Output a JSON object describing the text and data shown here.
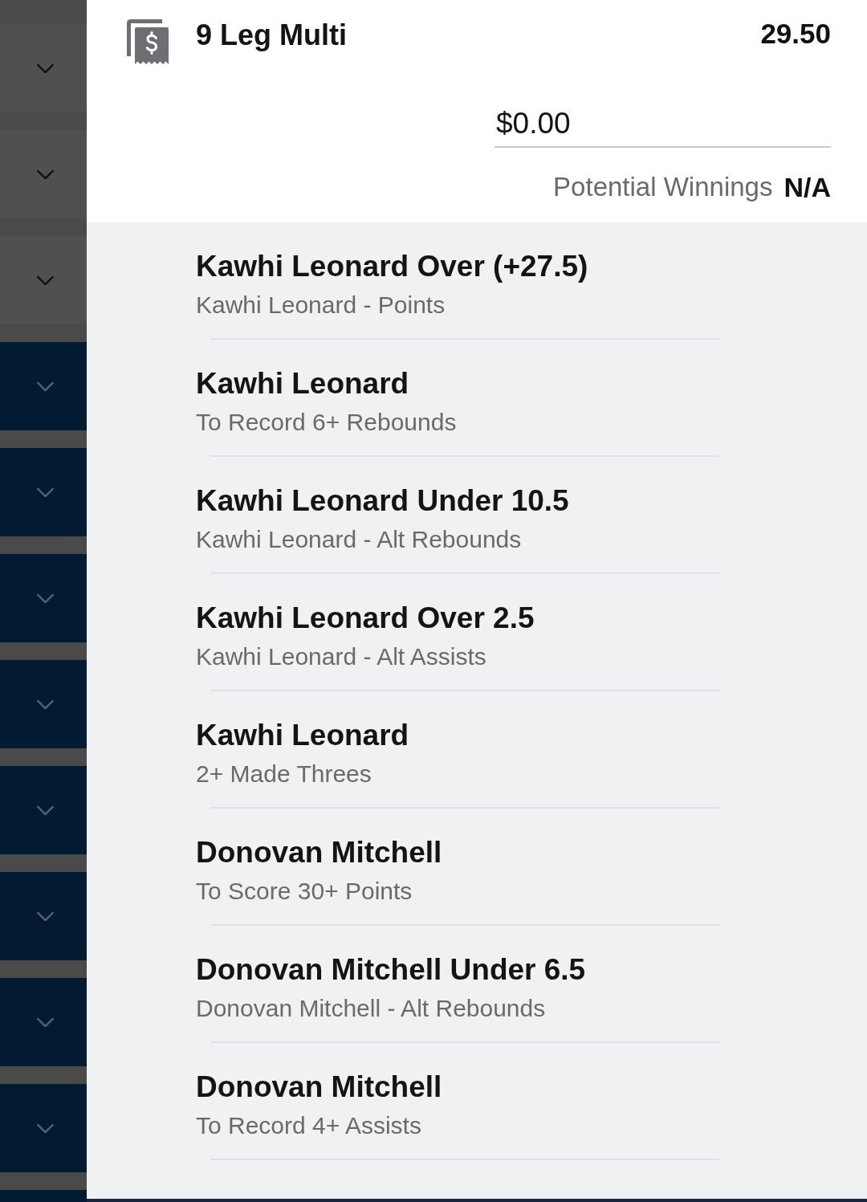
{
  "side_rows": [
    {
      "kind": "plain"
    },
    {
      "kind": "plain"
    },
    {
      "kind": "plain"
    },
    {
      "kind": "accent"
    },
    {
      "kind": "accent"
    },
    {
      "kind": "accent"
    },
    {
      "kind": "accent"
    },
    {
      "kind": "accent"
    },
    {
      "kind": "accent"
    },
    {
      "kind": "accent"
    },
    {
      "kind": "accent"
    }
  ],
  "bet": {
    "title": "9 Leg Multi",
    "odds": "29.50",
    "stake": {
      "value": "$0.00"
    },
    "winnings_label": "Potential Winnings",
    "winnings_value": "N/A"
  },
  "legs": [
    {
      "selection": "Kawhi Leonard Over (+27.5)",
      "market": "Kawhi Leonard - Points"
    },
    {
      "selection": "Kawhi Leonard",
      "market": "To Record 6+ Rebounds"
    },
    {
      "selection": "Kawhi Leonard Under 10.5",
      "market": "Kawhi Leonard - Alt Rebounds"
    },
    {
      "selection": "Kawhi Leonard Over 2.5",
      "market": "Kawhi Leonard - Alt Assists"
    },
    {
      "selection": "Kawhi Leonard",
      "market": "2+ Made Threes"
    },
    {
      "selection": "Donovan Mitchell",
      "market": "To Score 30+ Points"
    },
    {
      "selection": "Donovan Mitchell Under 6.5",
      "market": "Donovan Mitchell - Alt Rebounds"
    },
    {
      "selection": "Donovan Mitchell",
      "market": "To Record 4+ Assists"
    }
  ]
}
